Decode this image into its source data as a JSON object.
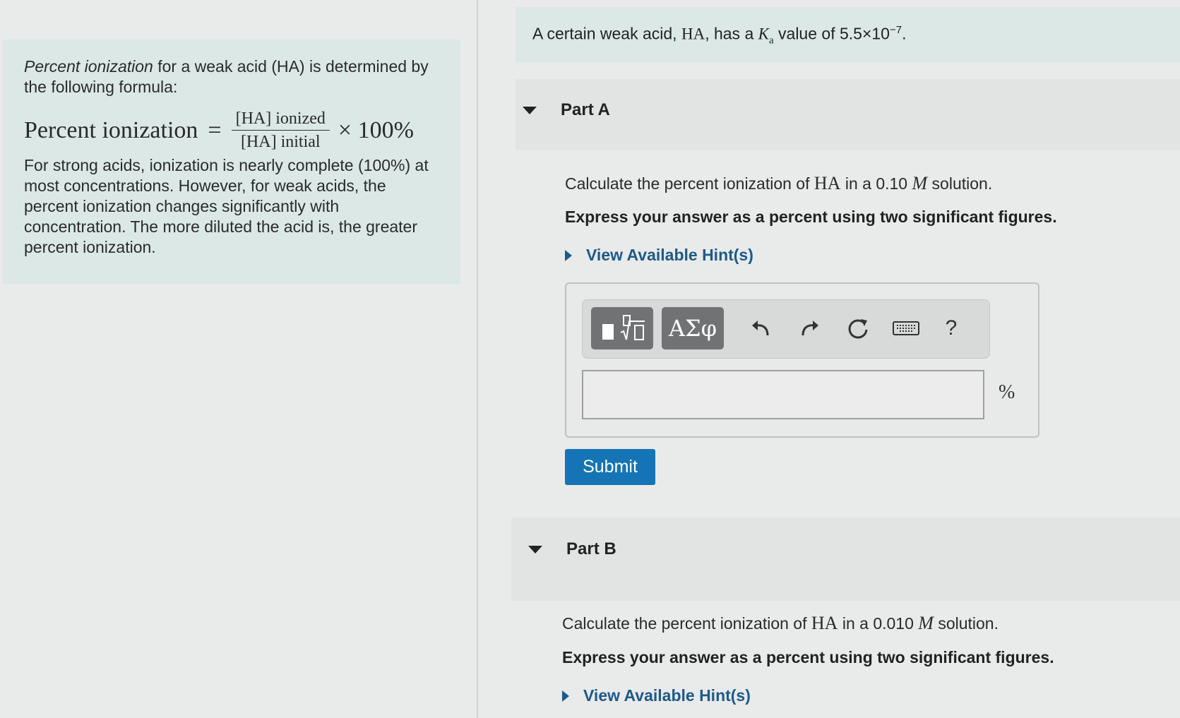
{
  "intro": {
    "lead_italic": "Percent ionization",
    "lead_rest": " for a weak acid (HA) is determined by the following formula:",
    "formula_lhs": "Percent ionization",
    "formula_eq": "=",
    "formula_num": "[HA] ionized",
    "formula_den": "[HA] initial",
    "formula_times": "× 100%",
    "body": "For strong acids, ionization is nearly complete (100%) at most concentrations. However, for weak acids, the percent ionization changes significantly with concentration. The more diluted the acid is, the greater percent ionization."
  },
  "problem": {
    "prefix": "A certain weak acid, ",
    "acid": "HA",
    "mid": ", has a ",
    "ka_symbol": "K",
    "ka_sub": "a",
    "value_text": " value of 5.5×10",
    "exponent": "−7",
    "end": "."
  },
  "partA": {
    "title": "Part A",
    "q_prefix": "Calculate the percent ionization of ",
    "q_acid": "HA",
    "q_mid": " in a 0.10 ",
    "q_unit": "M",
    "q_end": " solution.",
    "instruction": "Express your answer as a percent using two significant figures.",
    "hint": "View Available Hint(s)",
    "unit": "%",
    "submit": "Submit"
  },
  "toolbar": {
    "greek_label": "ΑΣφ",
    "help_label": "?"
  },
  "partB": {
    "title": "Part B",
    "q_prefix": "Calculate the percent ionization of ",
    "q_acid": "HA",
    "q_mid": " in a 0.010 ",
    "q_unit": "M",
    "q_end": " solution.",
    "instruction": "Express your answer as a percent using two significant figures.",
    "hint": "View Available Hint(s)"
  }
}
